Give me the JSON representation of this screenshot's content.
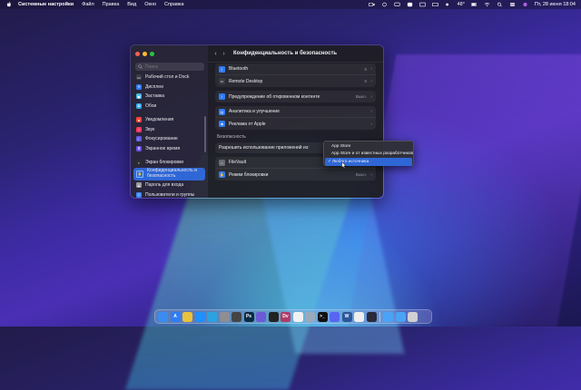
{
  "menubar": {
    "app_name": "Системные настройки",
    "items": [
      "Файл",
      "Правка",
      "Вид",
      "Окно",
      "Справка"
    ],
    "temperature": "48°",
    "datetime": "Пт, 28 июня 18:04"
  },
  "window": {
    "title": "Конфиденциальность и безопасность"
  },
  "sidebar": {
    "search_placeholder": "Поиск",
    "items": [
      {
        "label": "Рабочий стол и Dock",
        "icon": "dock-icon",
        "color": "#3a3a44"
      },
      {
        "label": "Дисплеи",
        "icon": "display-icon",
        "color": "#2f7bf6"
      },
      {
        "label": "Заставка",
        "icon": "screensaver-icon",
        "color": "#45b3e0"
      },
      {
        "label": "Обои",
        "icon": "wallpaper-icon",
        "color": "#2fa8e8"
      },
      {
        "label": "Уведомления",
        "icon": "bell-icon",
        "color": "#ff453a"
      },
      {
        "label": "Звук",
        "icon": "sound-icon",
        "color": "#ff375f"
      },
      {
        "label": "Фокусирование",
        "icon": "moon-icon",
        "color": "#5e5ce6"
      },
      {
        "label": "Экранное время",
        "icon": "hourglass-icon",
        "color": "#6e4ee8"
      },
      {
        "label": "Экран блокировки",
        "icon": "lock-screen-icon",
        "color": "#2c2c2e"
      },
      {
        "label": "Конфиденциальность и безопасность",
        "icon": "hand-icon",
        "color": "#1f6fe8"
      },
      {
        "label": "Пароль для входа",
        "icon": "lock-icon",
        "color": "#9a9aa0"
      },
      {
        "label": "Пользователи и группы",
        "icon": "users-icon",
        "color": "#3a86f5"
      }
    ]
  },
  "main": {
    "rows_group1": [
      {
        "label": "Bluetooth",
        "value": "0",
        "icon": "bluetooth-icon",
        "color": "#2f7bf6"
      },
      {
        "label": "Remote Desktop",
        "value": "0",
        "icon": "remote-desktop-icon",
        "color": "#3a3a44"
      }
    ],
    "rows_group2": [
      {
        "label": "Предупреждение об откровенном контенте",
        "value": "Выкл.",
        "icon": "warning-icon",
        "color": "#2f7bf6"
      }
    ],
    "rows_group3": [
      {
        "label": "Аналитика и улучшение",
        "icon": "analytics-icon",
        "color": "#2f7bf6"
      },
      {
        "label": "Реклама от Apple",
        "icon": "ads-icon",
        "color": "#2f7bf6"
      }
    ],
    "security_label": "Безопасность",
    "allow_label": "Разрешить использование приложений из:",
    "rows_group4": [
      {
        "label": "FileVault",
        "value": "Выкл.",
        "icon": "filevault-icon",
        "color": "#6a6a72"
      },
      {
        "label": "Режим блокировки",
        "value": "Выкл.",
        "icon": "lockdown-icon",
        "color": "#2f7bf6"
      }
    ]
  },
  "popup": {
    "options": [
      "App Store",
      "App Store и от известных разработчиков",
      "Любого источника"
    ],
    "selected_index": 2
  },
  "dock": {
    "apps": [
      {
        "name": "finder-icon",
        "color": "#3b8cf0",
        "glyph": ""
      },
      {
        "name": "appstore-icon",
        "color": "#2e7df6",
        "glyph": "A"
      },
      {
        "name": "chrome-icon",
        "color": "#e9c23a",
        "glyph": ""
      },
      {
        "name": "safari-icon",
        "color": "#1e90ff",
        "glyph": ""
      },
      {
        "name": "telegram-icon",
        "color": "#2aa3e0",
        "glyph": ""
      },
      {
        "name": "settings-icon",
        "color": "#8e8e93",
        "glyph": ""
      },
      {
        "name": "music-icon",
        "color": "#444",
        "glyph": ""
      },
      {
        "name": "photoshop-icon",
        "color": "#0a2a44",
        "glyph": "Ps"
      },
      {
        "name": "stacks-icon",
        "color": "#6b5bd6",
        "glyph": ""
      },
      {
        "name": "figma-icon",
        "color": "#222",
        "glyph": ""
      },
      {
        "name": "dev-icon",
        "color": "#b23a68",
        "glyph": "Dv"
      },
      {
        "name": "notes-icon",
        "color": "#f1f1f1",
        "glyph": ""
      },
      {
        "name": "preview-icon",
        "color": "#9ab",
        "glyph": ""
      },
      {
        "name": "terminal-icon",
        "color": "#111",
        "glyph": ">_"
      },
      {
        "name": "discord-icon",
        "color": "#5865f2",
        "glyph": ""
      },
      {
        "name": "word-icon",
        "color": "#2b579a",
        "glyph": "W"
      },
      {
        "name": "calendar-icon",
        "color": "#eee",
        "glyph": ""
      },
      {
        "name": "codeeditor-icon",
        "color": "#2a2a3a",
        "glyph": ""
      },
      {
        "name": "folder-icon",
        "color": "#4aa3f5",
        "glyph": ""
      },
      {
        "name": "downloads-icon",
        "color": "#4aa3f5",
        "glyph": ""
      },
      {
        "name": "trash-icon",
        "color": "#cfcfd4",
        "glyph": ""
      }
    ]
  }
}
